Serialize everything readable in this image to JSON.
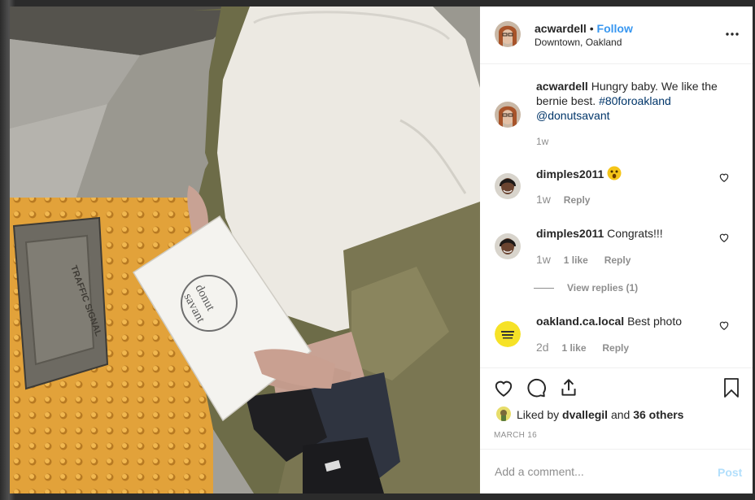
{
  "post": {
    "author": "acwardell",
    "follow_label": "Follow",
    "location": "Downtown, Oakland",
    "caption_author": "acwardell",
    "caption_text": "Hungry baby. We like the bernie best.",
    "caption_hashtag": "#80foroakland",
    "caption_mention": "@donutsavant",
    "caption_time": "1w"
  },
  "comments": [
    {
      "user": "dimples2011",
      "text": "",
      "emoji": "😮",
      "time": "1w",
      "likes": "",
      "reply": "Reply"
    },
    {
      "user": "dimples2011",
      "text": "Congrats!!!",
      "emoji": "",
      "time": "1w",
      "likes": "1 like",
      "reply": "Reply"
    },
    {
      "user": "oakland.ca.local",
      "text": "Best photo",
      "emoji": "",
      "time": "2d",
      "likes": "1 like",
      "reply": "Reply"
    }
  ],
  "view_replies": "View replies (1)",
  "likes": {
    "prefix": "Liked by",
    "user": "dvallegil",
    "and": "and",
    "others": "36 others"
  },
  "date": "MARCH 16",
  "add_comment": {
    "placeholder": "Add a comment...",
    "post_label": "Post"
  },
  "colors": {
    "accent": "#3897f0",
    "link": "#003569",
    "grey": "#8e8e8e"
  },
  "photo": {
    "box_text_1": "donut",
    "box_text_2": "savant",
    "sign_text": "TRAFFIC SIGNAL"
  }
}
